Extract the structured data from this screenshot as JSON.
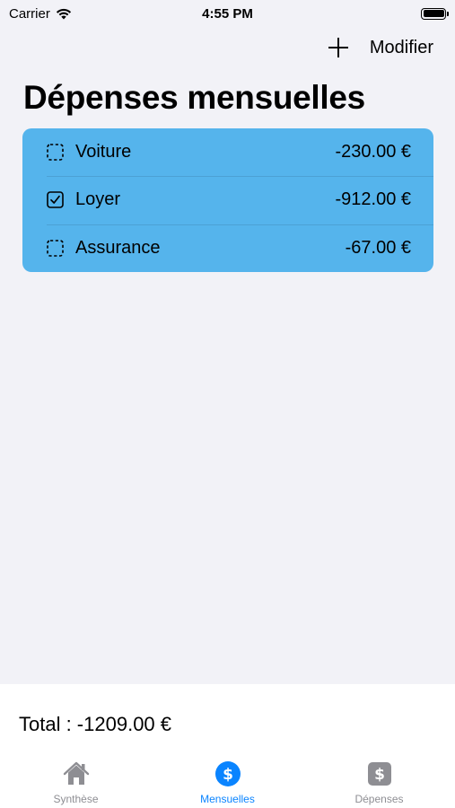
{
  "status_bar": {
    "carrier": "Carrier",
    "time": "4:55 PM"
  },
  "nav": {
    "edit_label": "Modifier"
  },
  "title": "Dépenses mensuelles",
  "expenses": [
    {
      "label": "Voiture",
      "amount": "-230.00 €",
      "checked": false
    },
    {
      "label": "Loyer",
      "amount": "-912.00 €",
      "checked": true
    },
    {
      "label": "Assurance",
      "amount": "-67.00 €",
      "checked": false
    }
  ],
  "total": "Total : -1209.00 €",
  "tabs": [
    {
      "label": "Synthèse",
      "icon": "house-icon",
      "active": false
    },
    {
      "label": "Mensuelles",
      "icon": "dollar-circle-icon",
      "active": true
    },
    {
      "label": "Dépenses",
      "icon": "dollar-square-icon",
      "active": false
    }
  ],
  "colors": {
    "card": "#55b4ec",
    "accent": "#0a84ff",
    "inactive": "#8e8e93",
    "background": "#f2f2f7"
  }
}
